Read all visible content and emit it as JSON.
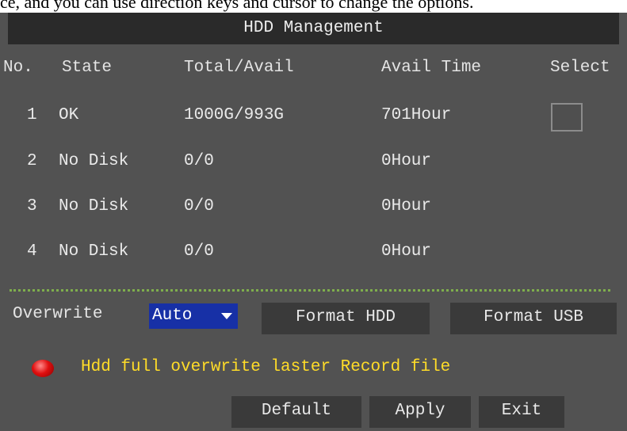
{
  "caption": "ce, and you can use direction keys and cursor to change the options.",
  "window": {
    "title": "HDD Management"
  },
  "table": {
    "headers": {
      "no": "No.",
      "state": "State",
      "total_avail": "Total/Avail",
      "avail_time": "Avail Time",
      "select": "Select"
    },
    "rows": [
      {
        "no": "1",
        "state": "OK",
        "total_avail": "1000G/993G",
        "avail_time": "701Hour",
        "has_checkbox": true,
        "checked": false
      },
      {
        "no": "2",
        "state": "No Disk",
        "total_avail": "0/0",
        "avail_time": "0Hour",
        "has_checkbox": false
      },
      {
        "no": "3",
        "state": "No Disk",
        "total_avail": "0/0",
        "avail_time": "0Hour",
        "has_checkbox": false
      },
      {
        "no": "4",
        "state": "No Disk",
        "total_avail": "0/0",
        "avail_time": "0Hour",
        "has_checkbox": false
      }
    ]
  },
  "controls": {
    "overwrite_label": "Overwrite",
    "overwrite_value": "Auto",
    "format_hdd_label": "Format HDD",
    "format_usb_label": "Format USB"
  },
  "status": {
    "indicator_color": "#e01010",
    "message": "Hdd full overwrite laster Record file"
  },
  "footer": {
    "default_label": "Default",
    "apply_label": "Apply",
    "exit_label": "Exit"
  },
  "colors": {
    "panel_bg": "#525252",
    "titlebar_bg": "#2a2a2a",
    "select_bg": "#1730a6",
    "message_color": "#ffdc28",
    "divider_color": "#7fae4c"
  }
}
